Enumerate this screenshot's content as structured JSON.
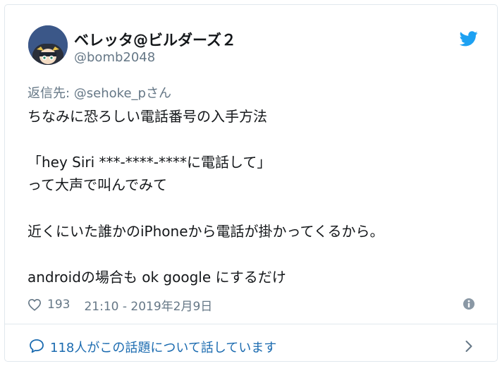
{
  "tweet": {
    "display_name": "ベレッタ@ビルダーズ２",
    "handle": "@bomb2048",
    "reply_to": "返信先: @sehoke_pさん",
    "lines": [
      "ちなみに恐ろしい電話番号の入手方法",
      "「hey Siri ***-****-****に電話して」",
      "って大声で叫んでみて",
      "近くにいた誰かのiPhoneから電話が掛かってくるから。",
      "androidの場合も ok google にするだけ"
    ],
    "likes": "193",
    "timestamp": "21:10 - 2019年2月9日"
  },
  "footer": {
    "conversation_text": "118人がこの話題について話しています"
  },
  "icons": {
    "brand": "twitter-bird-icon",
    "like": "heart-icon",
    "info": "info-icon",
    "conversation": "speech-bubble-icon",
    "more": "chevron-right-icon"
  },
  "colors": {
    "twitter_blue": "#1da1f2",
    "link_blue": "#1b6bb0",
    "secondary_text": "#657786",
    "border": "#e1e8ed"
  }
}
